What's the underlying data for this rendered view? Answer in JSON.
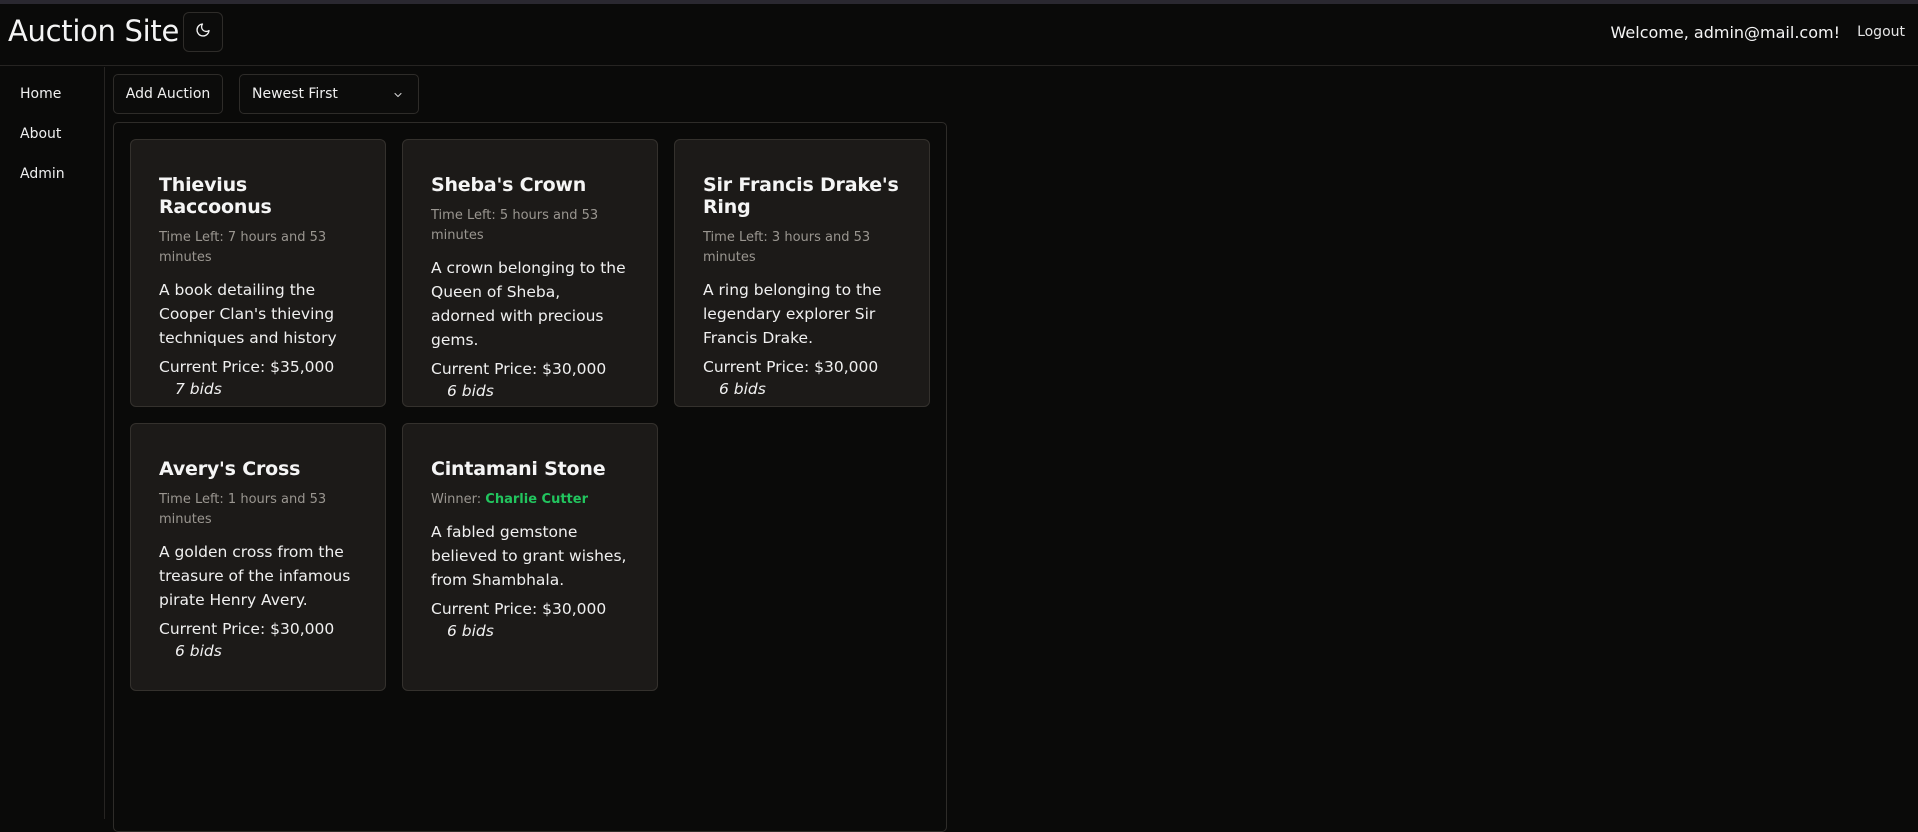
{
  "header": {
    "title": "Auction Site",
    "theme_toggle_icon": "moon-icon",
    "welcome": "Welcome, admin@mail.com!",
    "logout_label": "Logout"
  },
  "sidebar": {
    "items": [
      {
        "label": "Home"
      },
      {
        "label": "About"
      },
      {
        "label": "Admin"
      }
    ]
  },
  "toolbar": {
    "add_label": "Add Auction",
    "sort_value": "Newest First"
  },
  "auctions": [
    {
      "title": "Thievius Raccoonus",
      "meta_label": "Time Left: ",
      "meta_value": "7 hours and 53 minutes",
      "description": "A book detailing the Cooper Clan's thieving techniques and history",
      "price": "Current Price: $35,000",
      "bids": "7 bids"
    },
    {
      "title": "Sheba's Crown",
      "meta_label": "Time Left: ",
      "meta_value": "5 hours and 53 minutes",
      "description": "A crown belonging to the Queen of Sheba, adorned with precious gems.",
      "price": "Current Price: $30,000",
      "bids": "6 bids"
    },
    {
      "title": "Sir Francis Drake's Ring",
      "meta_label": "Time Left: ",
      "meta_value": "3 hours and 53 minutes",
      "description": "A ring belonging to the legendary explorer Sir Francis Drake.",
      "price": "Current Price: $30,000",
      "bids": "6 bids"
    },
    {
      "title": "Avery's Cross",
      "meta_label": "Time Left: ",
      "meta_value": "1 hours and 53 minutes",
      "description": "A golden cross from the treasure of the infamous pirate Henry Avery.",
      "price": "Current Price: $30,000",
      "bids": "6 bids"
    },
    {
      "title": "Cintamani Stone",
      "meta_label": "Winner: ",
      "winner": "Charlie Cutter",
      "description": "A fabled gemstone believed to grant wishes, from Shambhala.",
      "price": "Current Price: $30,000",
      "bids": "6 bids"
    }
  ],
  "colors": {
    "background": "#0a0a09",
    "card": "#1c1a18",
    "winner": "#22c55e"
  }
}
